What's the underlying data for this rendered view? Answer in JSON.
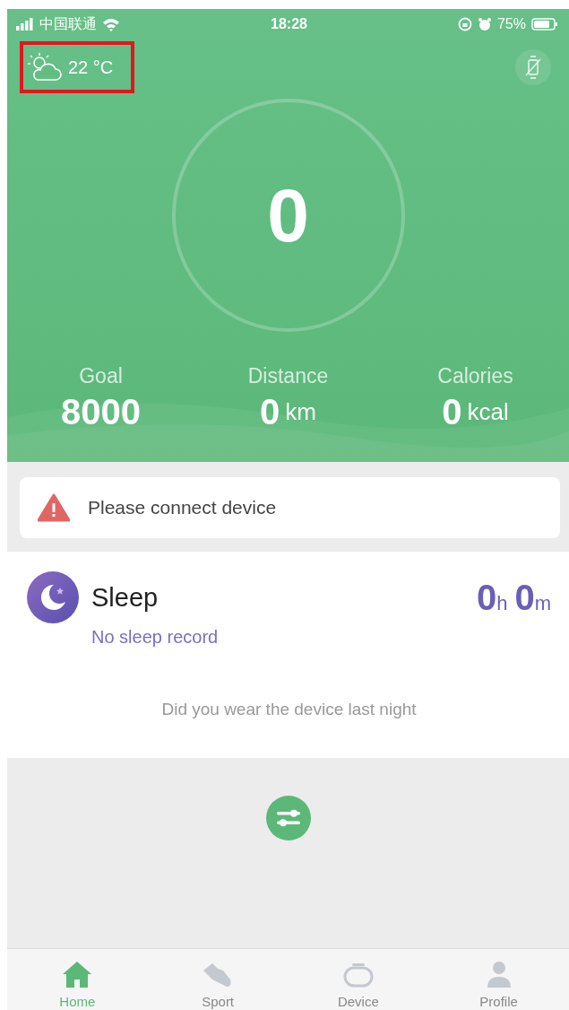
{
  "status_bar": {
    "carrier": "中国联通",
    "time": "18:28",
    "battery": "75%"
  },
  "weather": {
    "temperature": "22 °C",
    "highlighted": true
  },
  "steps": {
    "count": "0"
  },
  "stats": [
    {
      "label": "Goal",
      "value": "8000"
    },
    {
      "label": "Distance",
      "value": "0",
      "unit": "km"
    },
    {
      "label": "Calories",
      "value": "0",
      "unit": "kcal"
    }
  ],
  "alert": {
    "message": "Please connect device"
  },
  "sleep": {
    "title": "Sleep",
    "hours": "0",
    "hours_unit": "h",
    "minutes": "0",
    "minutes_unit": "m",
    "status": "No sleep record",
    "hint": "Did you wear the device last night"
  },
  "tabs": [
    {
      "label": "Home",
      "kind": "home",
      "selected": true
    },
    {
      "label": "Sport",
      "kind": "sport",
      "selected": false
    },
    {
      "label": "Device",
      "kind": "device",
      "selected": false
    },
    {
      "label": "Profile",
      "kind": "profile",
      "selected": false
    }
  ]
}
